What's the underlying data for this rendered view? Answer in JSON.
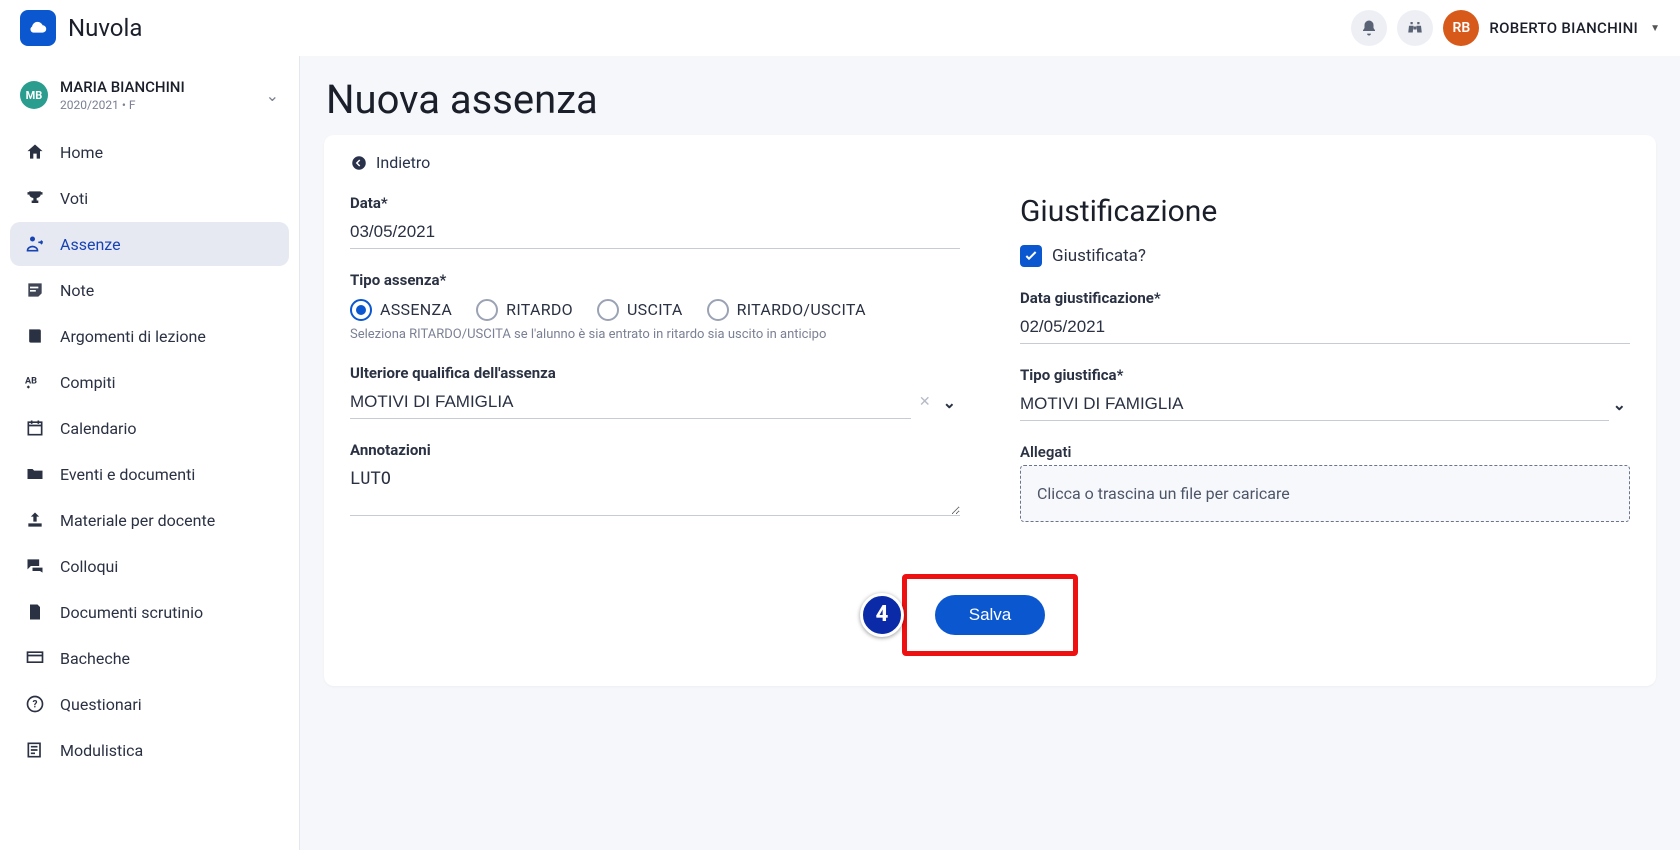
{
  "app": {
    "name": "Nuvola"
  },
  "user": {
    "initials": "RB",
    "name": "ROBERTO BIANCHINI"
  },
  "student": {
    "initials": "MB",
    "name": "MARIA BIANCHINI",
    "year": "2020/2021 • F"
  },
  "nav": {
    "home": "Home",
    "voti": "Voti",
    "assenze": "Assenze",
    "note": "Note",
    "argomenti": "Argomenti di lezione",
    "compiti": "Compiti",
    "calendario": "Calendario",
    "eventi": "Eventi e documenti",
    "materiale": "Materiale per docente",
    "colloqui": "Colloqui",
    "scrutinio": "Documenti scrutinio",
    "bacheche": "Bacheche",
    "questionari": "Questionari",
    "modulistica": "Modulistica"
  },
  "page": {
    "title": "Nuova assenza",
    "back": "Indietro"
  },
  "form": {
    "data_label": "Data*",
    "data_value": "03/05/2021",
    "tipo_label": "Tipo assenza*",
    "tipo_options": {
      "assenza": "ASSENZA",
      "ritardo": "RITARDO",
      "uscita": "USCITA",
      "ritardo_uscita": "RITARDO/USCITA"
    },
    "tipo_helper": "Seleziona RITARDO/USCITA se l'alunno è sia entrato in ritardo sia uscito in anticipo",
    "qualifica_label": "Ulteriore qualifica dell'assenza",
    "qualifica_value": "MOTIVI DI FAMIGLIA",
    "annotazioni_label": "Annotazioni",
    "annotazioni_value": "LUTO",
    "save": "Salva"
  },
  "just": {
    "title": "Giustificazione",
    "check_label": "Giustificata?",
    "data_label": "Data giustificazione*",
    "data_value": "02/05/2021",
    "tipo_label": "Tipo giustifica*",
    "tipo_value": "MOTIVI DI FAMIGLIA",
    "allegati_label": "Allegati",
    "dropzone": "Clicca o trascina un file per caricare"
  },
  "callout": {
    "number": "4"
  }
}
